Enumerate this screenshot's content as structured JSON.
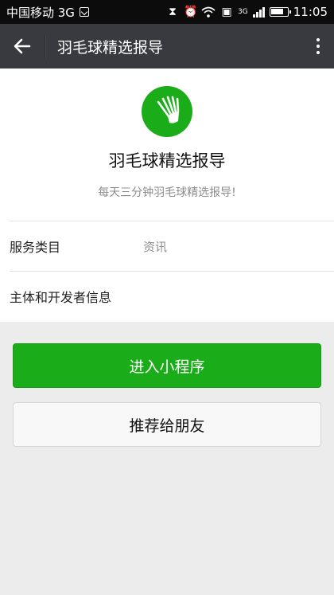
{
  "statusbar": {
    "carrier": "中国移动 3G",
    "network": "3G",
    "time": "11:05"
  },
  "navbar": {
    "title": "羽毛球精选报导"
  },
  "app": {
    "name": "羽毛球精选报导",
    "description": "每天三分钟羽毛球精选报导!",
    "logo_color": "#1aad19"
  },
  "info_rows": [
    {
      "label": "服务类目",
      "value": "资讯"
    },
    {
      "label": "主体和开发者信息",
      "value": ""
    }
  ],
  "actions": {
    "enter_label": "进入小程序",
    "share_label": "推荐给朋友"
  },
  "colors": {
    "accent": "#1aad19",
    "navbar": "#393a3f",
    "statusbar": "#0c0c0c"
  }
}
